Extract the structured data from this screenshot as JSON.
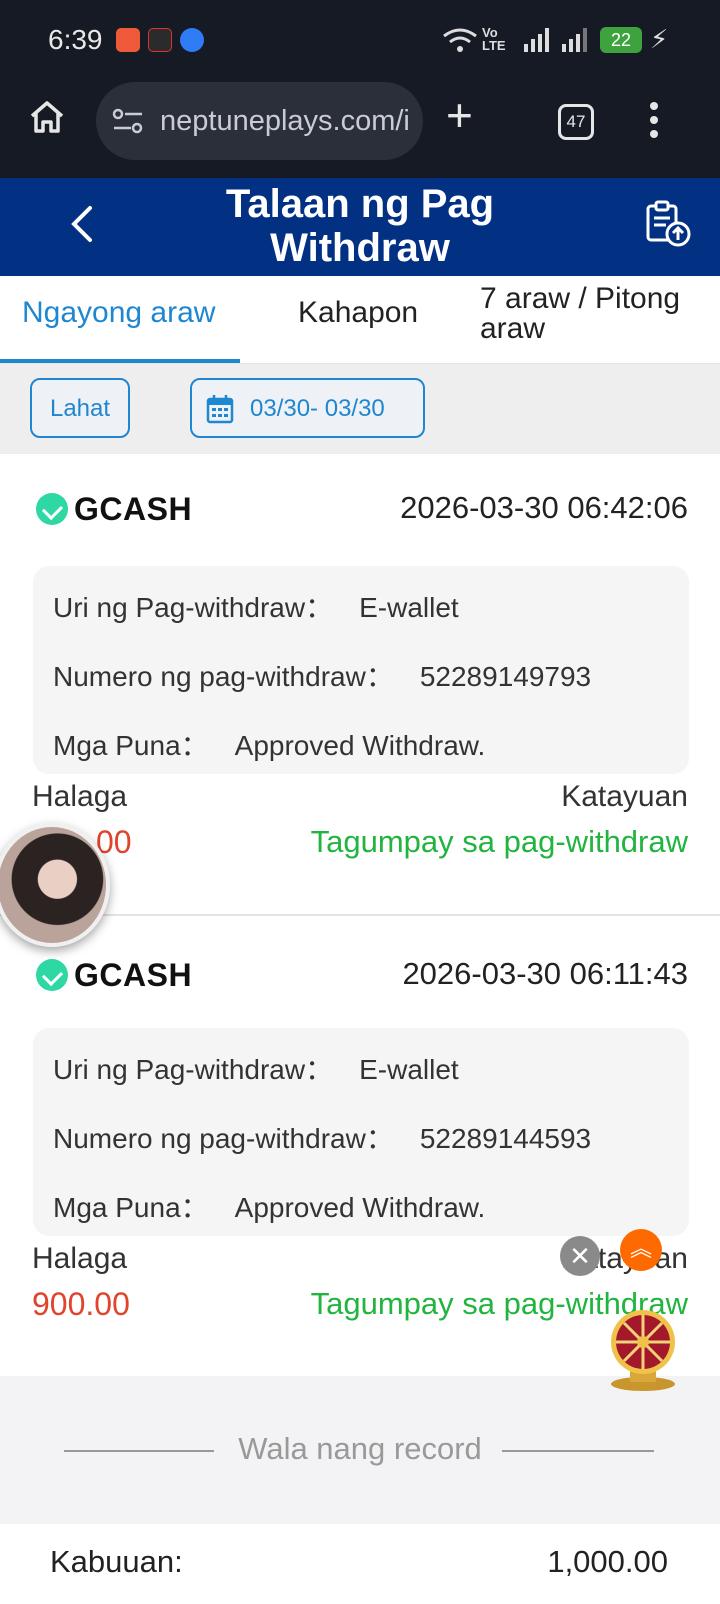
{
  "status_bar": {
    "time": "6:39",
    "battery": "22",
    "network": "Vo LTE"
  },
  "browser": {
    "url": "neptuneplays.com/i",
    "tab_count": "47"
  },
  "header": {
    "title_line1": "Talaan ng Pag",
    "title_line2": "Withdraw"
  },
  "tabs": [
    {
      "label": "Ngayong araw",
      "active": true
    },
    {
      "label": "Kahapon",
      "active": false
    },
    {
      "label_line1": "7 araw / Pitong",
      "label_line2": "araw",
      "active": false
    }
  ],
  "filters": {
    "all_label": "Lahat",
    "date_range": "03/30- 03/30"
  },
  "records": [
    {
      "provider": "GCASH",
      "datetime": "2026-03-30 06:42:06",
      "type_label": "Uri ng Pag-withdraw：",
      "type_value": "E-wallet",
      "number_label": "Numero ng pag-withdraw：",
      "number_value": "52289149793",
      "remarks_label": "Mga Puna：",
      "remarks_value": "Approved Withdraw.",
      "amount_label": "Halaga",
      "amount": "00",
      "status_label": "Katayuan",
      "status": "Tagumpay sa pag-withdraw"
    },
    {
      "provider": "GCASH",
      "datetime": "2026-03-30 06:11:43",
      "type_label": "Uri ng Pag-withdraw：",
      "type_value": "E-wallet",
      "number_label": "Numero ng pag-withdraw：",
      "number_value": "52289144593",
      "remarks_label": "Mga Puna：",
      "remarks_value": "Approved Withdraw.",
      "amount_label": "Halaga",
      "amount": "900.00",
      "status_label": "Katayuan",
      "status": "Tagumpay sa pag-withdraw"
    }
  ],
  "footer": {
    "no_more": "Wala nang record",
    "total_label": "Kabuuan:",
    "total_value": "1,000.00"
  },
  "colors": {
    "header_bg": "#023184",
    "accent": "#1f86d0",
    "amount": "#e0442c",
    "success": "#21b43f",
    "gcash": "#2ed8a4"
  }
}
